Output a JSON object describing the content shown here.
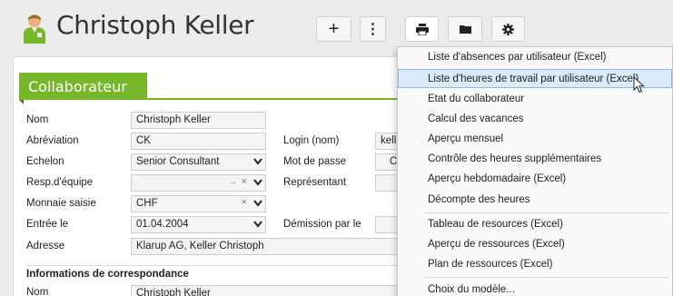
{
  "header": {
    "user_name": "Christoph Keller"
  },
  "toolbar": {
    "add_symbol": "+",
    "more_symbol": "⋮"
  },
  "section": {
    "title": "Collaborateur"
  },
  "form": {
    "nom_label": "Nom",
    "nom_value": "Christoph Keller",
    "abrev_label": "Abréviation",
    "abrev_value": "CK",
    "login_label": "Login (nom)",
    "login_value": "kell",
    "echelon_label": "Echelon",
    "echelon_value": "Senior Consultant",
    "motdepasse_label": "Mot de passe",
    "motdepasse_value": "C",
    "resp_label": "Resp.d'équipe",
    "resp_value": "",
    "representant_label": "Représentant",
    "monnaie_label": "Monnaie saisie",
    "monnaie_value": "CHF",
    "entree_label": "Entrée le",
    "entree_value": "01.04.2004",
    "demission_label": "Démission par le",
    "adresse_label": "Adresse",
    "adresse_value": "Klarup AG, Keller Christoph",
    "corresp_heading": "Informations de correspondance",
    "corresp_nom_label": "Nom",
    "corresp_nom_value": "Christoph Keller"
  },
  "menu": {
    "items": [
      "Liste d'absences par utilisateur (Excel)",
      "Liste d'heures de travail par utilisateur (Excel)",
      "Etat du collaborateur",
      "Calcul des vacances",
      "Aperçu mensuel",
      "Contrôle des heures supplémentaires",
      "Aperçu hebdomadaire (Excel)",
      "Décompte des heures",
      "Tableau de resources (Excel)",
      "Aperçu de ressources (Excel)",
      "Plan de ressources (Excel)",
      "Choix du modèle..."
    ],
    "hovered_index": 1
  },
  "colors": {
    "accent_green": "#76b82a",
    "menu_hover": "#dcebfb"
  }
}
